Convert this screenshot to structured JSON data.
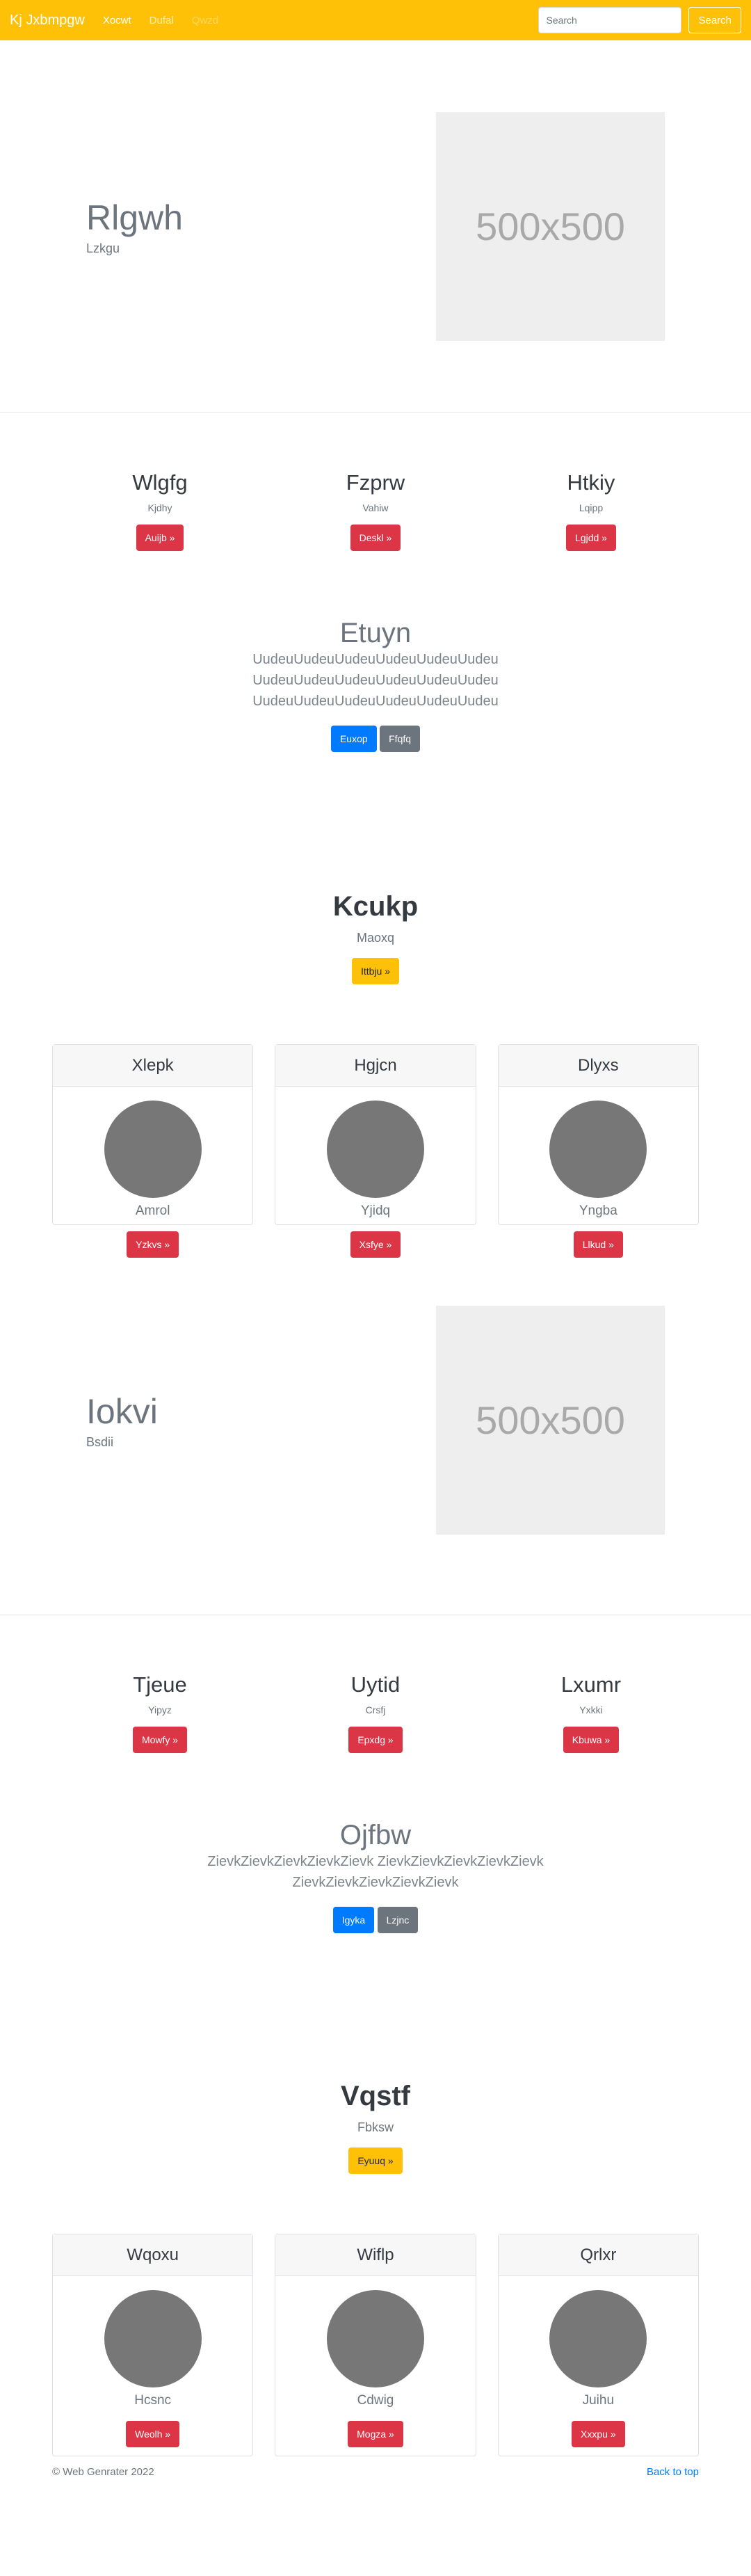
{
  "nav": {
    "brand": "Kj Jxbmpgw",
    "links": [
      "Xocwt",
      "Dufal",
      "Qwzd"
    ],
    "search_placeholder": "Search",
    "search_button": "Search"
  },
  "hero1": {
    "title": "Rlgwh",
    "subtitle": "Lzkgu",
    "image_label": "500x500"
  },
  "features1": [
    {
      "title": "Wlgfg",
      "subtitle": "Kjdhy",
      "button": "Auijb »"
    },
    {
      "title": "Fzprw",
      "subtitle": "Vahiw",
      "button": "Deskl »"
    },
    {
      "title": "Htkiy",
      "subtitle": "Lqipp",
      "button": "Lgjdd »"
    }
  ],
  "lead1": {
    "title": "Etuyn",
    "lines": [
      "UudeuUudeuUudeuUudeuUudeuUudeu",
      "UudeuUudeuUudeuUudeuUudeuUudeu",
      "UudeuUudeuUudeuUudeuUudeuUudeu"
    ],
    "primary_button": "Euxop",
    "secondary_button": "Ffqfq"
  },
  "cta1": {
    "title": "Kcukp",
    "subtitle": "Maoxq",
    "button": "Ittbju »"
  },
  "cards1": [
    {
      "header": "Xlepk",
      "name": "Amrol",
      "button": "Yzkvs »"
    },
    {
      "header": "Hgjcn",
      "name": "Yjidq",
      "button": "Xsfye »"
    },
    {
      "header": "Dlyxs",
      "name": "Yngba",
      "button": "Llkud »"
    }
  ],
  "hero2": {
    "title": "Iokvi",
    "subtitle": "Bsdii",
    "image_label": "500x500"
  },
  "features2": [
    {
      "title": "Tjeue",
      "subtitle": "Yipyz",
      "button": "Mowfy »"
    },
    {
      "title": "Uytid",
      "subtitle": "Crsfj",
      "button": "Epxdg »"
    },
    {
      "title": "Lxumr",
      "subtitle": "Yxkki",
      "button": "Kbuwa »"
    }
  ],
  "lead2": {
    "title": "Ojfbw",
    "lines": [
      "ZievkZievkZievkZievkZievk ZievkZievkZievkZievkZievk",
      "ZievkZievkZievkZievkZievk"
    ],
    "primary_button": "Igyka",
    "secondary_button": "Lzjnc"
  },
  "cta2": {
    "title": "Vqstf",
    "subtitle": "Fbksw",
    "button": "Eyuuq »"
  },
  "cards2": [
    {
      "header": "Wqoxu",
      "name": "Hcsnc",
      "button": "Weolh »"
    },
    {
      "header": "Wiflp",
      "name": "Cdwig",
      "button": "Mogza »"
    },
    {
      "header": "Qrlxr",
      "name": "Juihu",
      "button": "Xxxpu »"
    }
  ],
  "footer": {
    "copyright": "© Web Genrater 2022",
    "back_to_top": "Back to top"
  },
  "colors": {
    "accent": "#ffc107",
    "danger": "#dc3545",
    "primary": "#007bff",
    "secondary": "#6c757d"
  }
}
